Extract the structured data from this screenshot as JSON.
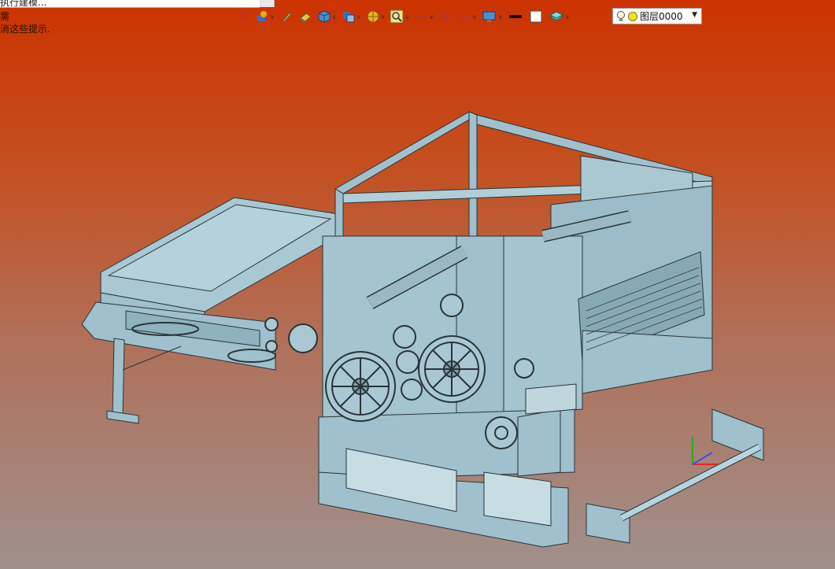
{
  "window": {
    "title_fragment": "执行建模..."
  },
  "hints": {
    "line1": "需",
    "line2": "消这些提示."
  },
  "toolbar": {
    "items": [
      {
        "icon": "exit-sketch-icon",
        "has_dropdown": false
      },
      {
        "icon": "sketch-tools-icon",
        "has_dropdown": true
      },
      {
        "icon": "pen-icon",
        "has_dropdown": false
      },
      {
        "icon": "eraser-icon",
        "has_dropdown": false
      },
      {
        "icon": "cube-view-icon",
        "has_dropdown": true
      },
      {
        "icon": "view-orientation-icon",
        "has_dropdown": true
      },
      {
        "icon": "render-style-icon",
        "has_dropdown": true
      },
      {
        "icon": "zoom-icon",
        "has_dropdown": true
      },
      {
        "icon": "snap-icon",
        "has_dropdown": true
      },
      {
        "icon": "section-icon",
        "has_dropdown": false
      },
      {
        "icon": "measure-icon",
        "has_dropdown": true
      },
      {
        "icon": "display-settings-icon",
        "has_dropdown": true
      },
      {
        "icon": "line-color-icon",
        "has_dropdown": false
      },
      {
        "icon": "fill-color-icon",
        "has_dropdown": false
      },
      {
        "icon": "layer-manager-icon",
        "has_dropdown": true
      }
    ],
    "layer_select": {
      "value": "图层0000"
    }
  },
  "colors": {
    "viewport_top": "#cc3300",
    "viewport_bottom": "#a0908c",
    "model_fill": "#9fc0cc",
    "model_edge": "#2a3438"
  }
}
